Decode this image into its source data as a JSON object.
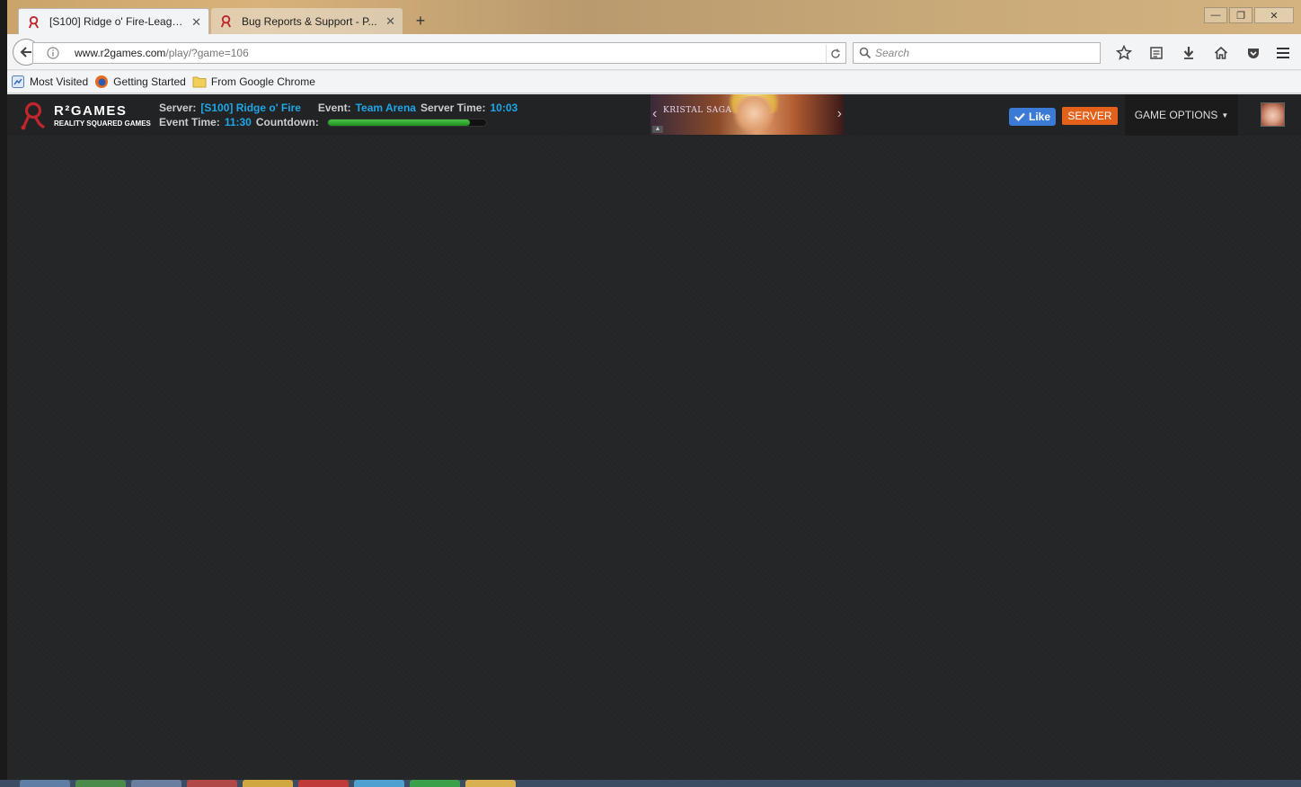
{
  "browser": {
    "tabs": [
      {
        "label": "[S100] Ridge o' Fire-League...",
        "active": true
      },
      {
        "label": "Bug Reports & Support - P...",
        "active": false
      }
    ],
    "url": {
      "domain": "www.r2games.com",
      "path": "/play/?game=106"
    },
    "search_placeholder": "Search",
    "bookmarks": [
      "Most Visited",
      "Getting Started",
      "From Google Chrome"
    ]
  },
  "game_bar": {
    "logo": {
      "name": "R²GAMES",
      "tagline": "REALITY SQUARED GAMES"
    },
    "server_label": "Server:",
    "server_value": "[S100] Ridge o' Fire",
    "event_label": "Event:",
    "event_value": "Team Arena",
    "server_time_label": "Server Time:",
    "server_time_value": "10:03",
    "event_time_label": "Event Time:",
    "event_time_value": "11:30",
    "countdown_label": "Countdown:",
    "countdown_progress": 0.9,
    "banner_title": "KRISTAL SAGA",
    "like_label": "Like",
    "server_button": "SERVER",
    "options_button": "GAME OPTIONS"
  },
  "colors": {
    "accent_blue": "#1ea7e8",
    "like_blue": "#3b7bd6",
    "server_orange": "#e3611a",
    "page_bg": "#242526"
  }
}
